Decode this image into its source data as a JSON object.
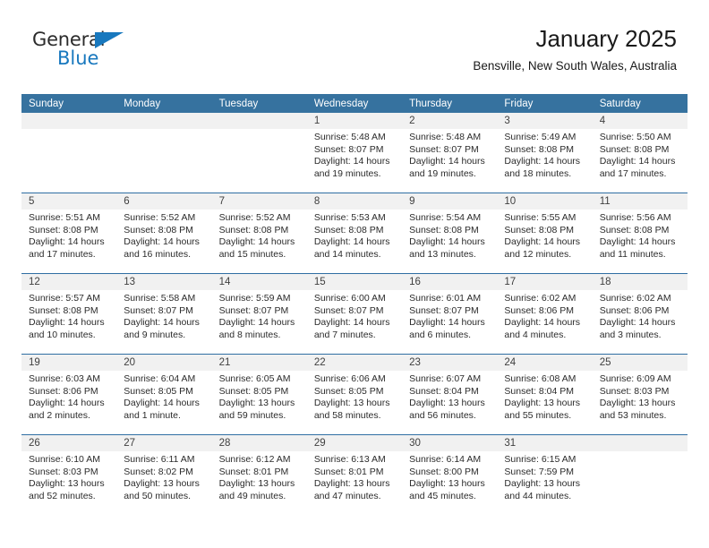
{
  "brand": {
    "name_part1": "General",
    "name_part2": "Blue",
    "triangle_color": "#1878be"
  },
  "header": {
    "title": "January 2025",
    "subtitle": "Bensville, New South Wales, Australia"
  },
  "theme": {
    "header_blue": "#36729f",
    "row_divider": "#2f6ea3",
    "daynum_band": "#f1f1f1"
  },
  "weekdays": [
    "Sunday",
    "Monday",
    "Tuesday",
    "Wednesday",
    "Thursday",
    "Friday",
    "Saturday"
  ],
  "labels": {
    "sunrise": "Sunrise:",
    "sunset": "Sunset:",
    "daylight": "Daylight:"
  },
  "weeks": [
    [
      {
        "day": "",
        "sunrise": "",
        "sunset": "",
        "daylight_line1": "",
        "daylight_line2": ""
      },
      {
        "day": "",
        "sunrise": "",
        "sunset": "",
        "daylight_line1": "",
        "daylight_line2": ""
      },
      {
        "day": "",
        "sunrise": "",
        "sunset": "",
        "daylight_line1": "",
        "daylight_line2": ""
      },
      {
        "day": "1",
        "sunrise": "Sunrise: 5:48 AM",
        "sunset": "Sunset: 8:07 PM",
        "daylight_line1": "Daylight: 14 hours",
        "daylight_line2": "and 19 minutes."
      },
      {
        "day": "2",
        "sunrise": "Sunrise: 5:48 AM",
        "sunset": "Sunset: 8:07 PM",
        "daylight_line1": "Daylight: 14 hours",
        "daylight_line2": "and 19 minutes."
      },
      {
        "day": "3",
        "sunrise": "Sunrise: 5:49 AM",
        "sunset": "Sunset: 8:08 PM",
        "daylight_line1": "Daylight: 14 hours",
        "daylight_line2": "and 18 minutes."
      },
      {
        "day": "4",
        "sunrise": "Sunrise: 5:50 AM",
        "sunset": "Sunset: 8:08 PM",
        "daylight_line1": "Daylight: 14 hours",
        "daylight_line2": "and 17 minutes."
      }
    ],
    [
      {
        "day": "5",
        "sunrise": "Sunrise: 5:51 AM",
        "sunset": "Sunset: 8:08 PM",
        "daylight_line1": "Daylight: 14 hours",
        "daylight_line2": "and 17 minutes."
      },
      {
        "day": "6",
        "sunrise": "Sunrise: 5:52 AM",
        "sunset": "Sunset: 8:08 PM",
        "daylight_line1": "Daylight: 14 hours",
        "daylight_line2": "and 16 minutes."
      },
      {
        "day": "7",
        "sunrise": "Sunrise: 5:52 AM",
        "sunset": "Sunset: 8:08 PM",
        "daylight_line1": "Daylight: 14 hours",
        "daylight_line2": "and 15 minutes."
      },
      {
        "day": "8",
        "sunrise": "Sunrise: 5:53 AM",
        "sunset": "Sunset: 8:08 PM",
        "daylight_line1": "Daylight: 14 hours",
        "daylight_line2": "and 14 minutes."
      },
      {
        "day": "9",
        "sunrise": "Sunrise: 5:54 AM",
        "sunset": "Sunset: 8:08 PM",
        "daylight_line1": "Daylight: 14 hours",
        "daylight_line2": "and 13 minutes."
      },
      {
        "day": "10",
        "sunrise": "Sunrise: 5:55 AM",
        "sunset": "Sunset: 8:08 PM",
        "daylight_line1": "Daylight: 14 hours",
        "daylight_line2": "and 12 minutes."
      },
      {
        "day": "11",
        "sunrise": "Sunrise: 5:56 AM",
        "sunset": "Sunset: 8:08 PM",
        "daylight_line1": "Daylight: 14 hours",
        "daylight_line2": "and 11 minutes."
      }
    ],
    [
      {
        "day": "12",
        "sunrise": "Sunrise: 5:57 AM",
        "sunset": "Sunset: 8:08 PM",
        "daylight_line1": "Daylight: 14 hours",
        "daylight_line2": "and 10 minutes."
      },
      {
        "day": "13",
        "sunrise": "Sunrise: 5:58 AM",
        "sunset": "Sunset: 8:07 PM",
        "daylight_line1": "Daylight: 14 hours",
        "daylight_line2": "and 9 minutes."
      },
      {
        "day": "14",
        "sunrise": "Sunrise: 5:59 AM",
        "sunset": "Sunset: 8:07 PM",
        "daylight_line1": "Daylight: 14 hours",
        "daylight_line2": "and 8 minutes."
      },
      {
        "day": "15",
        "sunrise": "Sunrise: 6:00 AM",
        "sunset": "Sunset: 8:07 PM",
        "daylight_line1": "Daylight: 14 hours",
        "daylight_line2": "and 7 minutes."
      },
      {
        "day": "16",
        "sunrise": "Sunrise: 6:01 AM",
        "sunset": "Sunset: 8:07 PM",
        "daylight_line1": "Daylight: 14 hours",
        "daylight_line2": "and 6 minutes."
      },
      {
        "day": "17",
        "sunrise": "Sunrise: 6:02 AM",
        "sunset": "Sunset: 8:06 PM",
        "daylight_line1": "Daylight: 14 hours",
        "daylight_line2": "and 4 minutes."
      },
      {
        "day": "18",
        "sunrise": "Sunrise: 6:02 AM",
        "sunset": "Sunset: 8:06 PM",
        "daylight_line1": "Daylight: 14 hours",
        "daylight_line2": "and 3 minutes."
      }
    ],
    [
      {
        "day": "19",
        "sunrise": "Sunrise: 6:03 AM",
        "sunset": "Sunset: 8:06 PM",
        "daylight_line1": "Daylight: 14 hours",
        "daylight_line2": "and 2 minutes."
      },
      {
        "day": "20",
        "sunrise": "Sunrise: 6:04 AM",
        "sunset": "Sunset: 8:05 PM",
        "daylight_line1": "Daylight: 14 hours",
        "daylight_line2": "and 1 minute."
      },
      {
        "day": "21",
        "sunrise": "Sunrise: 6:05 AM",
        "sunset": "Sunset: 8:05 PM",
        "daylight_line1": "Daylight: 13 hours",
        "daylight_line2": "and 59 minutes."
      },
      {
        "day": "22",
        "sunrise": "Sunrise: 6:06 AM",
        "sunset": "Sunset: 8:05 PM",
        "daylight_line1": "Daylight: 13 hours",
        "daylight_line2": "and 58 minutes."
      },
      {
        "day": "23",
        "sunrise": "Sunrise: 6:07 AM",
        "sunset": "Sunset: 8:04 PM",
        "daylight_line1": "Daylight: 13 hours",
        "daylight_line2": "and 56 minutes."
      },
      {
        "day": "24",
        "sunrise": "Sunrise: 6:08 AM",
        "sunset": "Sunset: 8:04 PM",
        "daylight_line1": "Daylight: 13 hours",
        "daylight_line2": "and 55 minutes."
      },
      {
        "day": "25",
        "sunrise": "Sunrise: 6:09 AM",
        "sunset": "Sunset: 8:03 PM",
        "daylight_line1": "Daylight: 13 hours",
        "daylight_line2": "and 53 minutes."
      }
    ],
    [
      {
        "day": "26",
        "sunrise": "Sunrise: 6:10 AM",
        "sunset": "Sunset: 8:03 PM",
        "daylight_line1": "Daylight: 13 hours",
        "daylight_line2": "and 52 minutes."
      },
      {
        "day": "27",
        "sunrise": "Sunrise: 6:11 AM",
        "sunset": "Sunset: 8:02 PM",
        "daylight_line1": "Daylight: 13 hours",
        "daylight_line2": "and 50 minutes."
      },
      {
        "day": "28",
        "sunrise": "Sunrise: 6:12 AM",
        "sunset": "Sunset: 8:01 PM",
        "daylight_line1": "Daylight: 13 hours",
        "daylight_line2": "and 49 minutes."
      },
      {
        "day": "29",
        "sunrise": "Sunrise: 6:13 AM",
        "sunset": "Sunset: 8:01 PM",
        "daylight_line1": "Daylight: 13 hours",
        "daylight_line2": "and 47 minutes."
      },
      {
        "day": "30",
        "sunrise": "Sunrise: 6:14 AM",
        "sunset": "Sunset: 8:00 PM",
        "daylight_line1": "Daylight: 13 hours",
        "daylight_line2": "and 45 minutes."
      },
      {
        "day": "31",
        "sunrise": "Sunrise: 6:15 AM",
        "sunset": "Sunset: 7:59 PM",
        "daylight_line1": "Daylight: 13 hours",
        "daylight_line2": "and 44 minutes."
      },
      {
        "day": "",
        "sunrise": "",
        "sunset": "",
        "daylight_line1": "",
        "daylight_line2": ""
      }
    ]
  ]
}
